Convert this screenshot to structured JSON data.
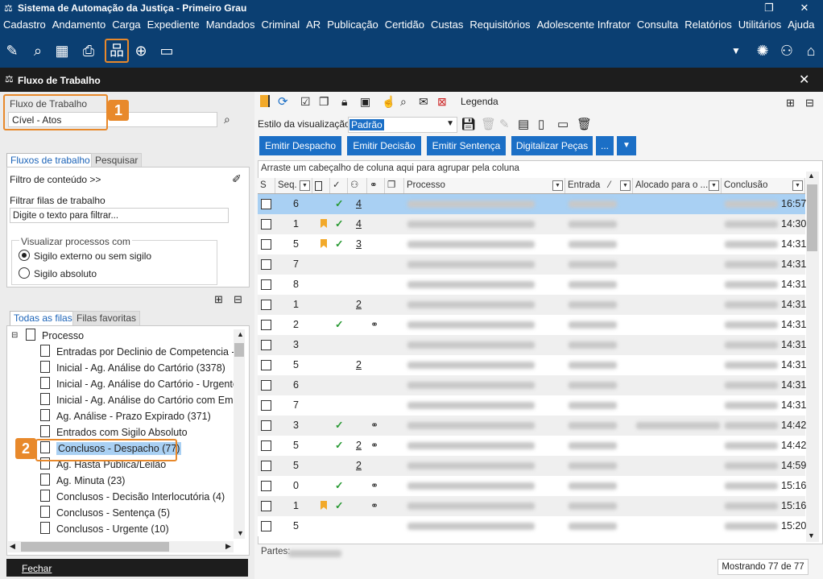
{
  "window": {
    "title": "Sistema de Automação da Justiça - Primeiro Grau",
    "restore_glyph": "❐",
    "close_glyph": "✕"
  },
  "menu": [
    "Cadastro",
    "Andamento",
    "Carga",
    "Expediente",
    "Mandados",
    "Criminal",
    "AR",
    "Publicação",
    "Certidão",
    "Custas",
    "Requisitórios",
    "Adolescente Infrator",
    "Consulta",
    "Relatórios",
    "Utilitários",
    "Ajuda"
  ],
  "docwindow": {
    "title": "Fluxo de Trabalho",
    "close_glyph": "✕"
  },
  "left": {
    "fluxo_label": "Fluxo de Trabalho",
    "fluxo_value": "Cível - Atos",
    "badge1": "1",
    "badge2": "2",
    "tab_fluxos": "Fluxos de trabalho",
    "tab_pesquisar": "Pesquisar",
    "filtro_conteudo": "Filtro de conteúdo >>",
    "filtrar_filas": "Filtrar filas de trabalho",
    "filter_placeholder": "Digite o texto para filtrar...",
    "visualizar_title": "Visualizar processos com",
    "radio1": "Sigilo externo ou sem sigilo",
    "radio2": "Sigilo absoluto",
    "tab_todas": "Todas as filas",
    "tab_favoritas": "Filas favoritas",
    "tree_root": "Processo",
    "tree_items": [
      "Entradas por Declinio de Competencia - T",
      "Inicial - Ag. Análise do Cartório (3378)",
      "Inicial - Ag. Análise do Cartório - Urgente",
      "Inicial - Ag. Análise do Cartório com Emer",
      "Ag. Análise - Prazo Expirado (371)",
      "Entrados com Sigilo Absoluto",
      "Conclusos - Despacho (77)",
      "Ag. Hasta Pública/Leilão",
      "Ag. Minuta (23)",
      "Conclusos - Decisão Interlocutória (4)",
      "Conclusos - Sentença (5)",
      "Conclusos - Urgente (10)"
    ],
    "fechar": "Fechar"
  },
  "right": {
    "legenda": "Legenda",
    "estilo_label": "Estilo da visualização",
    "estilo_value": "Padrão",
    "buttons": [
      "Emitir Despacho",
      "Emitir Decisão",
      "Emitir Sentença",
      "Digitalizar Peças",
      "..."
    ],
    "group_hint": "Arraste um cabeçalho de coluna aqui para agrupar pela coluna",
    "columns": {
      "s": "S",
      "seq": "Seq.",
      "processo": "Processo",
      "entrada": "Entrada",
      "alocado": "Alocado para o ...",
      "conclusao": "Conclusão"
    },
    "rows": [
      {
        "seq": "6",
        "flag": false,
        "check": true,
        "num": "4",
        "chain": false,
        "time": "16:57"
      },
      {
        "seq": "1",
        "flag": true,
        "check": true,
        "num": "4",
        "chain": false,
        "time": "14:30"
      },
      {
        "seq": "5",
        "flag": true,
        "check": true,
        "num": "3",
        "chain": false,
        "time": "14:31"
      },
      {
        "seq": "7",
        "flag": false,
        "check": false,
        "num": "",
        "chain": false,
        "time": "14:31"
      },
      {
        "seq": "8",
        "flag": false,
        "check": false,
        "num": "",
        "chain": false,
        "time": "14:31"
      },
      {
        "seq": "1",
        "flag": false,
        "check": false,
        "num": "2",
        "chain": false,
        "time": "14:31"
      },
      {
        "seq": "2",
        "flag": false,
        "check": true,
        "num": "",
        "chain": true,
        "time": "14:31"
      },
      {
        "seq": "3",
        "flag": false,
        "check": false,
        "num": "",
        "chain": false,
        "time": "14:31"
      },
      {
        "seq": "5",
        "flag": false,
        "check": false,
        "num": "2",
        "chain": false,
        "time": "14:31"
      },
      {
        "seq": "6",
        "flag": false,
        "check": false,
        "num": "",
        "chain": false,
        "time": "14:31"
      },
      {
        "seq": "7",
        "flag": false,
        "check": false,
        "num": "",
        "chain": false,
        "time": "14:31"
      },
      {
        "seq": "3",
        "flag": false,
        "check": true,
        "num": "",
        "chain": true,
        "time": "14:42"
      },
      {
        "seq": "5",
        "flag": false,
        "check": true,
        "num": "2",
        "chain": true,
        "time": "14:42"
      },
      {
        "seq": "5",
        "flag": false,
        "check": false,
        "num": "2",
        "chain": false,
        "time": "14:59"
      },
      {
        "seq": "0",
        "flag": false,
        "check": true,
        "num": "",
        "chain": true,
        "time": "15:16"
      },
      {
        "seq": "1",
        "flag": true,
        "check": true,
        "num": "",
        "chain": true,
        "time": "15:16"
      },
      {
        "seq": "5",
        "flag": false,
        "check": false,
        "num": "",
        "chain": false,
        "time": "15:20"
      }
    ],
    "partes_label": "Partes:",
    "mostrando": "Mostrando 77 de 77"
  }
}
